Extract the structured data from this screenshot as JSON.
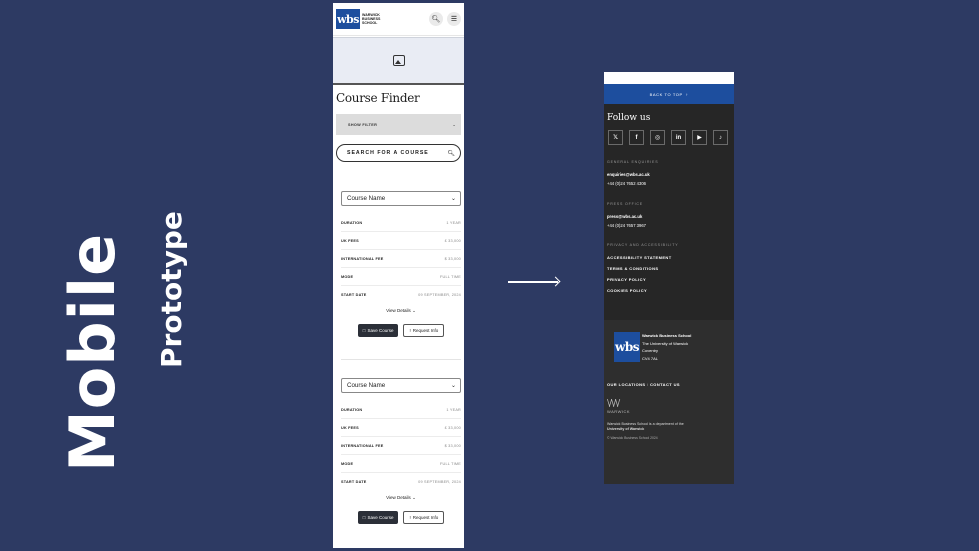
{
  "heading": {
    "main": "Mobile",
    "sub": "Prototype"
  },
  "left_phone": {
    "logo_mark": "wbs",
    "logo_text": [
      "WARWICK",
      "BUSINESS",
      "SCHOOL"
    ],
    "icons": {
      "search": "search-icon",
      "menu": "hamburger-menu-icon",
      "hero": "image-placeholder-icon"
    },
    "page_title": "Course Finder",
    "filter_label": "SHOW FILTER",
    "search_label": "SEARCH FOR A COURSE",
    "cards": [
      {
        "select_label": "Course Name",
        "rows": [
          {
            "key": "DURATION",
            "value": "1 YEAR"
          },
          {
            "key": "UK FEES",
            "value": "£ 33,000"
          },
          {
            "key": "INTERNATIONAL FEE",
            "value": "$ 33,000"
          },
          {
            "key": "MODE",
            "value": "FULL TIME"
          },
          {
            "key": "START DATE",
            "value": "09 SEPTEMBER, 2024"
          }
        ],
        "view_details": "View Details",
        "save_label": "Save Course",
        "request_label": "Request Info"
      },
      {
        "select_label": "Course Name",
        "rows": [
          {
            "key": "DURATION",
            "value": "1 YEAR"
          },
          {
            "key": "UK FEES",
            "value": "£ 33,000"
          },
          {
            "key": "INTERNATIONAL FEE",
            "value": "$ 33,000"
          },
          {
            "key": "MODE",
            "value": "FULL TIME"
          },
          {
            "key": "START DATE",
            "value": "09 SEPTEMBER, 2024"
          }
        ],
        "view_details": "View Details",
        "save_label": "Save Course",
        "request_label": "Request Info"
      }
    ]
  },
  "right_phone": {
    "back_to_top": "BACK TO TOP",
    "follow_title": "Follow us",
    "socials": [
      {
        "glyph": "𝕏",
        "icon": "x-twitter-icon"
      },
      {
        "glyph": "f",
        "icon": "facebook-icon"
      },
      {
        "glyph": "◎",
        "icon": "instagram-icon"
      },
      {
        "glyph": "in",
        "icon": "linkedin-icon"
      },
      {
        "glyph": "▶",
        "icon": "youtube-icon"
      },
      {
        "glyph": "♪",
        "icon": "tiktok-icon"
      }
    ],
    "general_heading": "GENERAL ENQUIRIES",
    "general_email": "enquiries@wbs.ac.uk",
    "general_phone": "+44 (0)24 7652 4306",
    "press_heading": "PRESS OFFICE",
    "press_email": "press@wbs.ac.uk",
    "press_phone": "+44 (0)24 7657 3967",
    "privacy_heading": "PRIVACY AND ACCESSIBILITY",
    "policy_links": [
      "ACCESSIBILITY STATEMENT",
      "TERMS & CONDITIONS",
      "PRIVACY POLICY",
      "COOKIES POLICY"
    ],
    "address": {
      "logo_mark": "wbs",
      "name": "Warwick Business School",
      "lines": [
        "The University of Warwick",
        "Coventry",
        "CV4 7AL"
      ]
    },
    "our_locations": "OUR LOCATIONS",
    "contact_us": "CONTACT US",
    "warwick_mark": "WARWICK",
    "dept_line1": "Warwick Business School is a department of the",
    "dept_line2": "University of Warwick",
    "copyright": "© Warwick Business School 2024"
  }
}
